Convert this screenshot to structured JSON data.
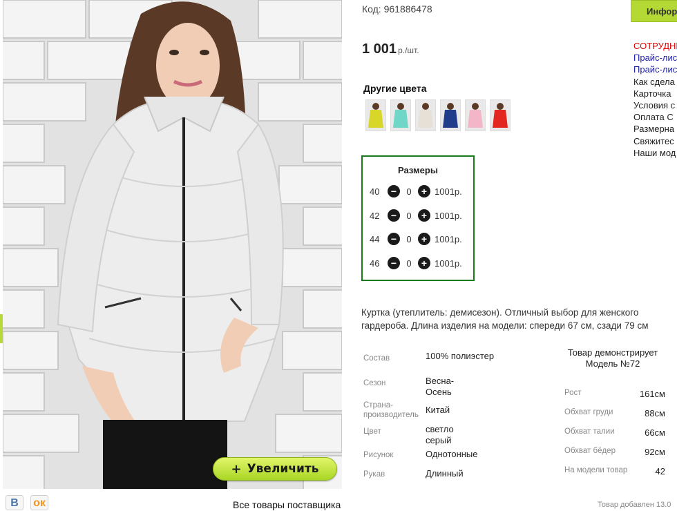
{
  "product": {
    "code_label": "Код: 961886478",
    "price_value": "1 001",
    "price_unit": "р./шт.",
    "zoom_label": "Увеличить",
    "zoom_plus": "+"
  },
  "colors": {
    "title": "Другие цвета",
    "swatches": [
      "#d9d62a",
      "#6fd6c8",
      "#e6e0d6",
      "#1f3d8a",
      "#f3b6c8",
      "#e3261f"
    ]
  },
  "sizes": {
    "title": "Размеры",
    "rows": [
      {
        "size": "40",
        "qty": "0",
        "price": "1001р."
      },
      {
        "size": "42",
        "qty": "0",
        "price": "1001р."
      },
      {
        "size": "44",
        "qty": "0",
        "price": "1001р."
      },
      {
        "size": "46",
        "qty": "0",
        "price": "1001р."
      }
    ]
  },
  "description": "Куртка (утеплитель: демисезон). Отличный выбор для женского гардероба. Длина изделия на модели: спереди 67 см, сзади 79 см",
  "properties": [
    {
      "label": "Состав",
      "value": "100% полиэстер"
    },
    {
      "label": "Сезон",
      "value": "Весна-Осень"
    },
    {
      "label": "Страна-производитель",
      "value": "Китай"
    },
    {
      "label": "Цвет",
      "value": "светло серый"
    },
    {
      "label": "Рисунок",
      "value": "Однотонные"
    },
    {
      "label": "Рукав",
      "value": "Длинный"
    }
  ],
  "model": {
    "heading": "Товар демонстрирует Модель №72",
    "rows": [
      {
        "label": "Рост",
        "value": "161см"
      },
      {
        "label": "Обхват груди",
        "value": "88см"
      },
      {
        "label": "Обхват талии",
        "value": "66см"
      },
      {
        "label": "Обхват бёдер",
        "value": "92см"
      },
      {
        "label": "На модели товар",
        "value": "42"
      }
    ]
  },
  "sidebar": {
    "info_button": "Инфор",
    "links": [
      "СОТРУДНИ",
      "Прайс-лис",
      "Прайс-лис",
      "Как сдела",
      "Карточка",
      "Условия с",
      "Оплата С",
      "Размерна",
      "Свяжитес",
      "Наши мод"
    ]
  },
  "footer": {
    "vk": "В",
    "ok": "ок",
    "all_goods": "Все товары поставщика",
    "added": "Товар добавлен 13.0"
  },
  "colors_ui": {
    "accent": "#b5d934",
    "sizes_border": "#1a7a1a",
    "link_red": "#e00000",
    "link_blue": "#1a1aa6"
  }
}
